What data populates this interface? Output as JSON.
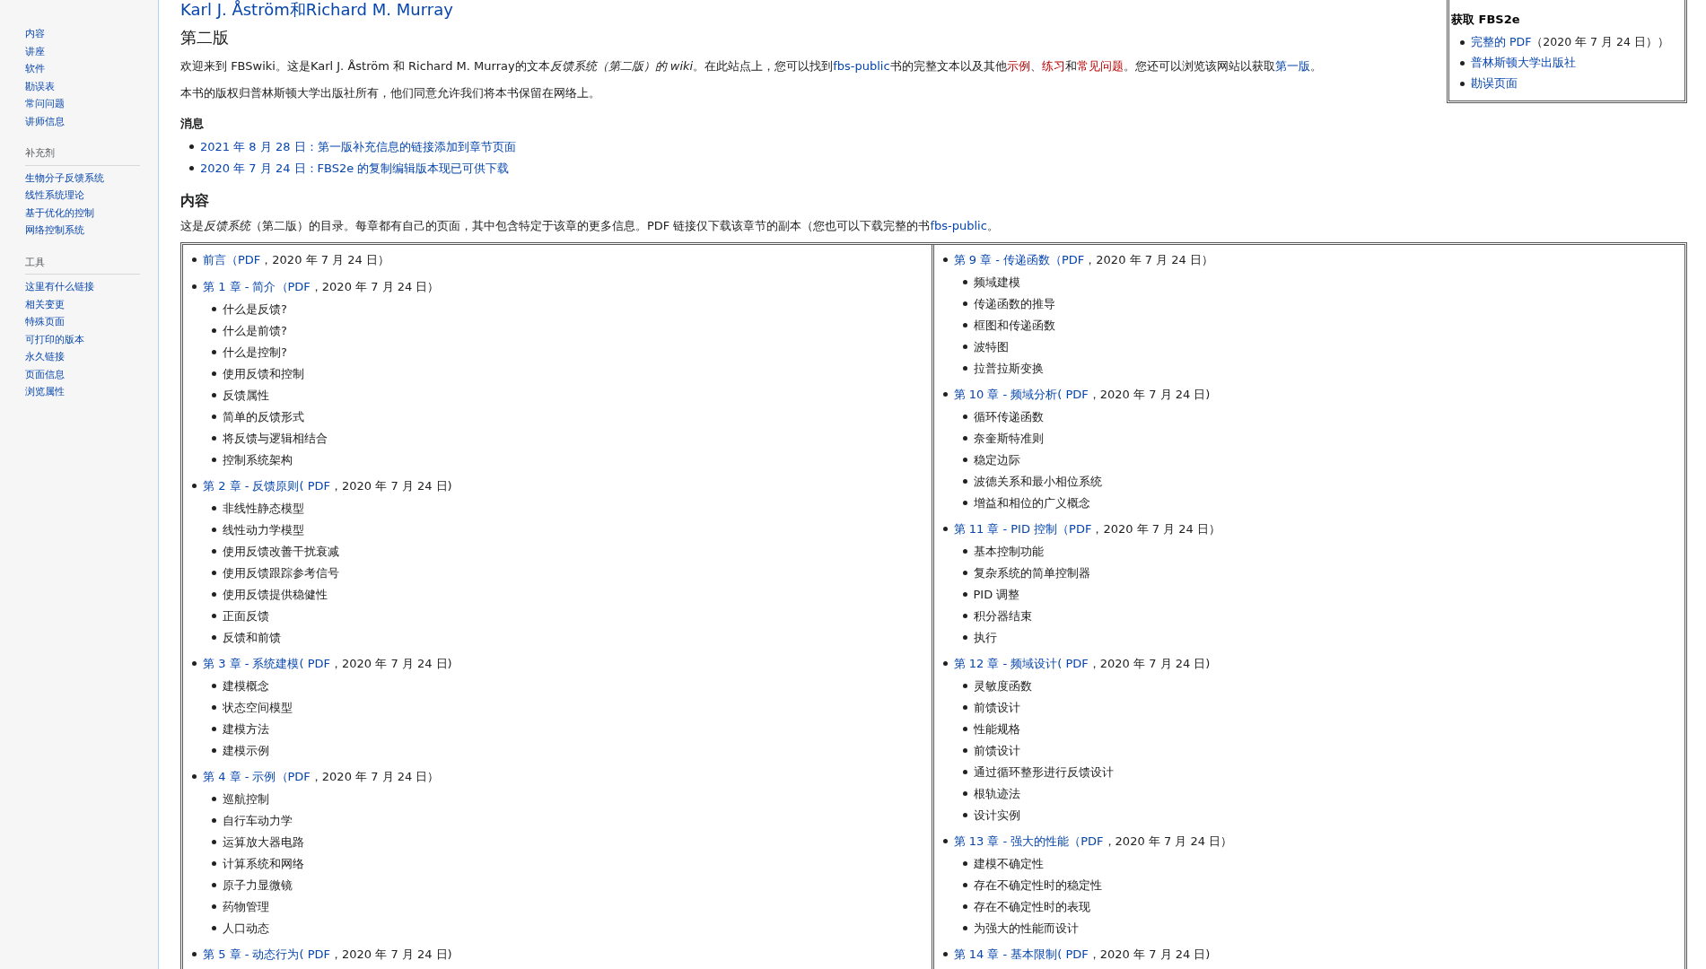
{
  "sidebar": {
    "sections": [
      {
        "items": [
          "内容",
          "讲座",
          "软件",
          "勘误表",
          "常问问题",
          "讲师信息"
        ]
      },
      {
        "heading": "补充剂",
        "items": [
          "生物分子反馈系统",
          "线性系统理论",
          "基于优化的控制",
          "网络控制系统"
        ]
      },
      {
        "heading": "工具",
        "items": [
          "这里有什么链接",
          "相关变更",
          "特殊页面",
          "可打印的版本",
          "永久链接",
          "页面信息",
          "浏览属性"
        ]
      }
    ]
  },
  "header": {
    "authors": "Karl J. Åström和Richard M. Murray",
    "edition": "第二版"
  },
  "intro": [
    {
      "kind": "text",
      "text": "欢迎来到 FBSwiki。这是Karl J. Åström 和 Richard M. Murray的文本"
    },
    {
      "kind": "italic",
      "text": "反馈系统（第二版）的 wiki"
    },
    {
      "kind": "text",
      "text": "。在此站点上，您可以找到"
    },
    {
      "kind": "link",
      "text": "fbs-public"
    },
    {
      "kind": "text",
      "text": "书的完整文本以及其他"
    },
    {
      "kind": "redlink",
      "text": "示例"
    },
    {
      "kind": "text",
      "text": "、"
    },
    {
      "kind": "redlink",
      "text": "练习"
    },
    {
      "kind": "text",
      "text": "和"
    },
    {
      "kind": "redlink",
      "text": "常见问题"
    },
    {
      "kind": "text",
      "text": "。您还可以浏览该网站以获取"
    },
    {
      "kind": "link",
      "text": "第一版"
    },
    {
      "kind": "text",
      "text": "。"
    }
  ],
  "copyright": "本书的版权归普林斯顿大学出版社所有，他们同意允许我们将本书保留在网络上。",
  "news": {
    "heading": "消息",
    "items": [
      "2021 年 8 月 28 日：第一版补充信息的链接添加到章节页面",
      "2020 年 7 月 24 日：FBS2e 的复制编辑版本现已可供下载"
    ]
  },
  "contents": {
    "heading": "内容",
    "intro": [
      {
        "kind": "text",
        "text": "这是"
      },
      {
        "kind": "italic",
        "text": "反馈系统"
      },
      {
        "kind": "text",
        "text": "（第二版）的目录。每章都有自己的页面，其中包含特定于该章的更多信息。PDF 链接仅下载该章节的副本（您也可以下载完整的书"
      },
      {
        "kind": "link",
        "text": "fbs-public"
      },
      {
        "kind": "text",
        "text": "。"
      }
    ],
    "columns": [
      [
        {
          "title": "前言",
          "pdf": "（PDF",
          "rest": "，2020 年 7 月 24 日）"
        },
        {
          "title": "第 1 章 - 简介",
          "pdf": "（PDF",
          "rest": "，2020 年 7 月 24 日）",
          "children": [
            "什么是反馈?",
            "什么是前馈?",
            "什么是控制?",
            "使用反馈和控制",
            "反馈属性",
            "简单的反馈形式",
            "将反馈与逻辑相结合",
            "控制系统架构"
          ]
        },
        {
          "title": "第 2 章 - 反馈原则",
          "pdf": "( PDF",
          "rest": "，2020 年 7 月 24 日)",
          "children": [
            "非线性静态模型",
            "线性动力学模型",
            "使用反馈改善干扰衰减",
            "使用反馈跟踪参考信号",
            "使用反馈提供稳健性",
            "正面反馈",
            "反馈和前馈"
          ]
        },
        {
          "title": "第 3 章 - 系统建模",
          "pdf": "( PDF",
          "rest": "，2020 年 7 月 24 日)",
          "children": [
            "建模概念",
            "状态空间模型",
            "建模方法",
            "建模示例"
          ]
        },
        {
          "title": "第 4 章 - 示例",
          "pdf": "（PDF",
          "rest": "，2020 年 7 月 24 日）",
          "children": [
            "巡航控制",
            "自行车动力学",
            "运算放大器电路",
            "计算系统和网络",
            "原子力显微镜",
            "药物管理",
            "人口动态"
          ]
        },
        {
          "title": "第 5 章 - 动态行为",
          "pdf": "( PDF",
          "rest": "，2020 年 7 月 24 日)"
        }
      ],
      [
        {
          "title": "第 9 章 - 传递函数",
          "pdf": "（PDF",
          "rest": "，2020 年 7 月 24 日）",
          "children": [
            "频域建模",
            "传递函数的推导",
            "框图和传递函数",
            "波特图",
            "拉普拉斯变换"
          ]
        },
        {
          "title": "第 10 章 - 频域分析",
          "pdf": "( PDF",
          "rest": "，2020 年 7 月 24 日)",
          "children": [
            "循环传递函数",
            "奈奎斯特准则",
            "稳定边际",
            "波德关系和最小相位系统",
            "增益和相位的广义概念"
          ]
        },
        {
          "title": "第 11 章 - PID 控制",
          "pdf": "（PDF",
          "rest": "，2020 年 7 月 24 日）",
          "children": [
            "基本控制功能",
            "复杂系统的简单控制器",
            "PID 调整",
            "积分器结束",
            "执行"
          ]
        },
        {
          "title": "第 12 章 - 频域设计",
          "pdf": "( PDF",
          "rest": "，2020 年 7 月 24 日)",
          "children": [
            "灵敏度函数",
            "前馈设计",
            "性能规格",
            "前馈设计",
            "通过循环整形进行反馈设计",
            "根轨迹法",
            "设计实例"
          ]
        },
        {
          "title": "第 13 章 - 强大的性能",
          "pdf": "（PDF",
          "rest": "，2020 年 7 月 24 日）",
          "children": [
            "建模不确定性",
            "存在不确定性时的稳定性",
            "存在不确定性时的表现",
            "为强大的性能而设计"
          ]
        },
        {
          "title": "第 14 章 - 基本限制",
          "pdf": "( PDF",
          "rest": "，2020 年 7 月 24 日)"
        }
      ]
    ]
  },
  "infobox": {
    "heading": "获取 FBS2e",
    "items": [
      {
        "link": "完整的 PDF",
        "text": "（2020 年 7 月 24 日））"
      },
      {
        "link": "普林斯顿大学出版社"
      },
      {
        "link": "勘误页面"
      }
    ]
  }
}
